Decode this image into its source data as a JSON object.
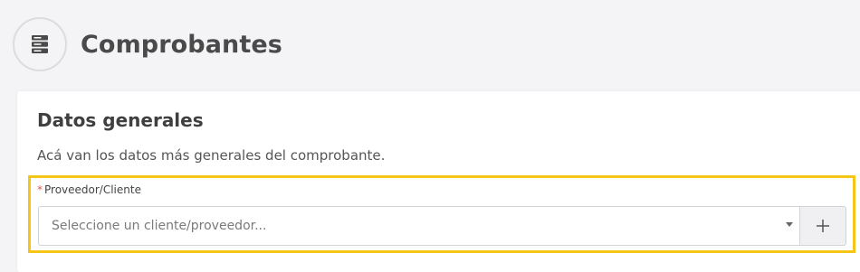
{
  "header": {
    "title": "Comprobantes",
    "icon": "server-stack-icon"
  },
  "card": {
    "title": "Datos generales",
    "subtitle": "Acá van los datos más generales del comprobante."
  },
  "field": {
    "required_mark": "*",
    "label": "Proveedor/Cliente",
    "placeholder": "Seleccione un cliente/proveedor...",
    "add_button_icon": "plus-icon"
  },
  "colors": {
    "highlight": "#f5c518",
    "required": "#e45757",
    "background": "#f4f4f6"
  }
}
